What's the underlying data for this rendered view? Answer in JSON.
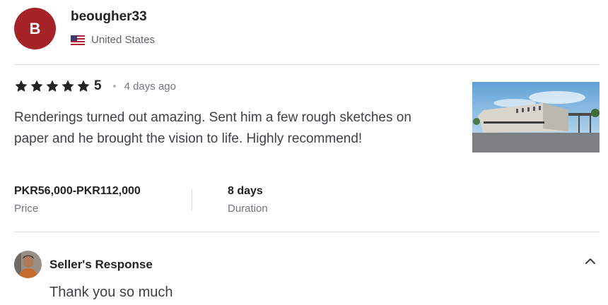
{
  "reviewer": {
    "avatar_letter": "B",
    "avatar_color": "#a52226",
    "username": "beougher33",
    "country": "United States",
    "flag_icon": "us-flag-icon"
  },
  "review": {
    "stars": 5,
    "rating": "5",
    "time_ago": "4 days ago",
    "text": "Renderings turned out amazing. Sent him a few rough sketches on paper and he brought the vision to life. Highly recommend!",
    "price_value": "PKR56,000-PKR112,000",
    "price_label": "Price",
    "duration_value": "8 days",
    "duration_label": "Duration"
  },
  "seller_response": {
    "title": "Seller's Response",
    "text": "Thank you so much",
    "toggle_icon": "chevron-up-icon"
  }
}
